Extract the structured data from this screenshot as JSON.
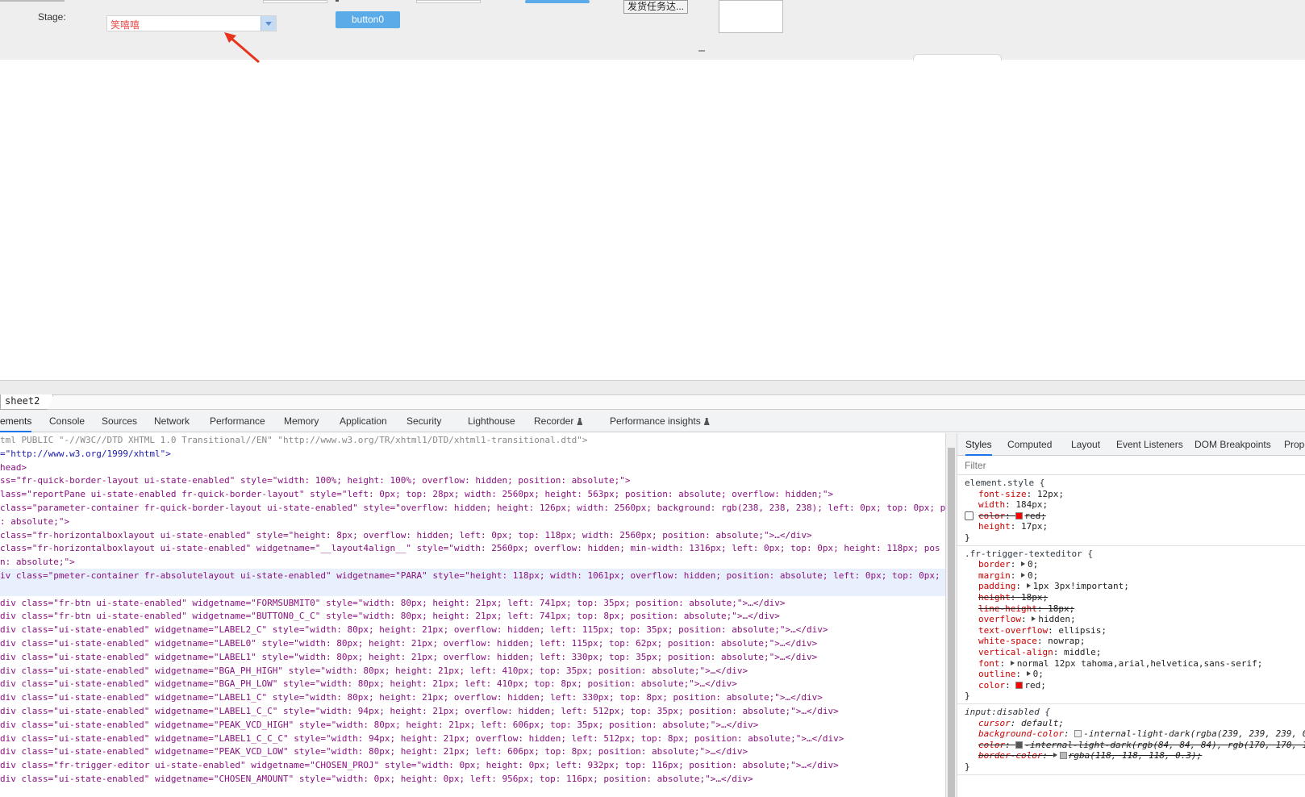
{
  "report": {
    "stage_label": "Stage:",
    "stage_value": "笑嘻嘻",
    "button0_label": "button0",
    "dispatch_label": "发货任务达..."
  },
  "sheet_tab": "sheet2",
  "devtools": {
    "tabs": [
      "ements",
      "Console",
      "Sources",
      "Network",
      "Performance",
      "Memory",
      "Application",
      "Security",
      "Lighthouse",
      "Recorder",
      "Performance insights"
    ],
    "active_tab": "ements"
  },
  "elements_lines": [
    {
      "t": "tml PUBLIC \"-//W3C//DTD XHTML 1.0 Transitional//EN\" \"http://www.w3.org/TR/xhtml1/DTD/xhtml1-transitional.dtd\">",
      "k": "doctype"
    },
    {
      "t": "=\"http://www.w3.org/1999/xhtml\">",
      "k": "val"
    },
    {
      "t": "head>",
      "k": "tag"
    },
    {
      "t": "ss=\"fr-quick-border-layout ui-state-enabled\" style=\"width: 100%; height: 100%; overflow: hidden; position: absolute;\">",
      "k": "mix"
    },
    {
      "t": "lass=\"reportPane ui-state-enabled fr-quick-border-layout\" style=\"left: 0px; top: 28px; width: 2560px; height: 563px; position: absolute; overflow: hidden;\">",
      "k": "mix"
    },
    {
      "t": "class=\"parameter-container fr-quick-border-layout ui-state-enabled\" style=\"overflow: hidden; height: 126px; width: 2560px; background: rgb(238, 238, 238); left: 0px; top: 0px; po",
      "k": "mix"
    },
    {
      "t": ": absolute;\">",
      "k": "mix"
    },
    {
      "t": " class=\"fr-horizontalboxlayout ui-state-enabled\" style=\"height: 8px; overflow: hidden; left: 0px; top: 118px; width: 2560px; position: absolute;\">…</div>",
      "k": "mix"
    },
    {
      "t": " class=\"fr-horizontalboxlayout ui-state-enabled\" widgetname=\"__layout4align__\" style=\"width: 2560px; overflow: hidden; min-width: 1316px; left: 0px; top: 0px; height: 118px; pos",
      "k": "mix"
    },
    {
      "t": "n: absolute;\">",
      "k": "mix"
    },
    {
      "t": "iv class=\"pmeter-container fr-absolutelayout ui-state-enabled\" widgetname=\"PARA\" style=\"height: 118px; width: 1061px; overflow: hidden; position: absolute; left: 0px; top: 0px;",
      "k": "sel"
    },
    {
      "t": "",
      "k": "sel"
    },
    {
      "t": "div class=\"fr-btn ui-state-enabled\" widgetname=\"FORMSUBMIT0\" style=\"width: 80px; height: 21px; left: 741px; top: 35px; position: absolute;\">…</div>",
      "k": "mix"
    },
    {
      "t": "div class=\"fr-btn ui-state-enabled\" widgetname=\"BUTTON0_C_C\" style=\"width: 80px; height: 21px; left: 741px; top: 8px; position: absolute;\">…</div>",
      "k": "mix"
    },
    {
      "t": "div class=\"ui-state-enabled\" widgetname=\"LABEL2_C\" style=\"width: 80px; height: 21px; overflow: hidden; left: 115px; top: 35px; position: absolute;\">…</div>",
      "k": "mix"
    },
    {
      "t": "div class=\"ui-state-enabled\" widgetname=\"LABEL0\" style=\"width: 80px; height: 21px; overflow: hidden; left: 115px; top: 62px; position: absolute;\">…</div>",
      "k": "mix"
    },
    {
      "t": "div class=\"ui-state-enabled\" widgetname=\"LABEL1\" style=\"width: 80px; height: 21px; overflow: hidden; left: 330px; top: 35px; position: absolute;\">…</div>",
      "k": "mix"
    },
    {
      "t": "div class=\"ui-state-enabled\" widgetname=\"BGA_PH_HIGH\" style=\"width: 80px; height: 21px; left: 410px; top: 35px; position: absolute;\">…</div>",
      "k": "mix"
    },
    {
      "t": "div class=\"ui-state-enabled\" widgetname=\"BGA_PH_LOW\" style=\"width: 80px; height: 21px; left: 410px; top: 8px; position: absolute;\">…</div>",
      "k": "mix"
    },
    {
      "t": "div class=\"ui-state-enabled\" widgetname=\"LABEL1_C\" style=\"width: 80px; height: 21px; overflow: hidden; left: 330px; top: 8px; position: absolute;\">…</div>",
      "k": "mix"
    },
    {
      "t": "div class=\"ui-state-enabled\" widgetname=\"LABEL1_C_C\" style=\"width: 94px; height: 21px; overflow: hidden; left: 512px; top: 35px; position: absolute;\">…</div>",
      "k": "mix"
    },
    {
      "t": "div class=\"ui-state-enabled\" widgetname=\"PEAK_VCD_HIGH\" style=\"width: 80px; height: 21px; left: 606px; top: 35px; position: absolute;\">…</div>",
      "k": "mix"
    },
    {
      "t": "div class=\"ui-state-enabled\" widgetname=\"LABEL1_C_C_C\" style=\"width: 94px; height: 21px; overflow: hidden; left: 512px; top: 8px; position: absolute;\">…</div>",
      "k": "mix"
    },
    {
      "t": "div class=\"ui-state-enabled\" widgetname=\"PEAK_VCD_LOW\" style=\"width: 80px; height: 21px; left: 606px; top: 8px; position: absolute;\">…</div>",
      "k": "mix"
    },
    {
      "t": "div class=\"fr-trigger-editor ui-state-enabled\" widgetname=\"CHOSEN_PROJ\" style=\"width: 0px; height: 0px; left: 932px; top: 116px; position: absolute;\">…</div>",
      "k": "mix"
    },
    {
      "t": "div class=\"ui-state-enabled\" widgetname=\"CHOSEN_AMOUNT\" style=\"width: 0px; height: 0px; left: 956px; top: 116px; position: absolute;\">…</div>",
      "k": "mix"
    }
  ],
  "styles_tabs": [
    "Styles",
    "Computed",
    "Layout",
    "Event Listeners",
    "DOM Breakpoints",
    "Prope"
  ],
  "styles_active": "Styles",
  "filter_placeholder": "Filter",
  "rules": {
    "element_style": {
      "selector": "element.style {",
      "props": [
        {
          "name": "font-size",
          "value": "12px;"
        },
        {
          "name": "width",
          "value": "184px;"
        },
        {
          "name": "color",
          "value": "red;",
          "struck": true,
          "swatch": "#ff0000",
          "checkbox": true
        },
        {
          "name": "height",
          "value": "17px;"
        }
      ]
    },
    "trigger": {
      "selector": ".fr-trigger-texteditor {",
      "props": [
        {
          "name": "border",
          "value": "0;",
          "expand": true
        },
        {
          "name": "margin",
          "value": "0;",
          "expand": true
        },
        {
          "name": "padding",
          "value": "1px 3px!important;",
          "expand": true
        },
        {
          "name": "height",
          "value": "18px;",
          "struck": true
        },
        {
          "name": "line-height",
          "value": "18px;",
          "struck": true
        },
        {
          "name": "overflow",
          "value": "hidden;",
          "expand": true
        },
        {
          "name": "text-overflow",
          "value": "ellipsis;"
        },
        {
          "name": "white-space",
          "value": "nowrap;"
        },
        {
          "name": "vertical-align",
          "value": "middle;"
        },
        {
          "name": "font",
          "value": "normal 12px tahoma,arial,helvetica,sans-serif;",
          "expand": true
        },
        {
          "name": "outline",
          "value": "0;",
          "expand": true
        },
        {
          "name": "color",
          "value": "red;",
          "swatch": "#ff0000"
        }
      ]
    },
    "disabled": {
      "selector": "input:disabled {",
      "props": [
        {
          "name": "cursor",
          "value": "default;"
        },
        {
          "name": "background-color",
          "value": "-internal-light-dark(rgba(239, 239, 239, 0",
          "swatch": "#efefef"
        },
        {
          "name": "color",
          "value": "-internal-light-dark(rgb(84, 84, 84), rgb(170, 170, 1",
          "struck": true,
          "swatch": "#545454",
          "swatch2": "#aaaaaa"
        },
        {
          "name": "border-color",
          "value": "rgba(118, 118, 118, 0.3);",
          "struck": true,
          "expand": true,
          "swatch": "#bbbbbb"
        }
      ]
    },
    "close": "}"
  },
  "colors": {
    "accent": "#1a73e8",
    "button_blue": "#5aabe8",
    "prop_name": "#c80000"
  }
}
